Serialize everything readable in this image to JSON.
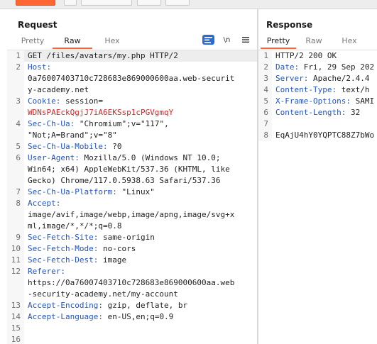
{
  "request": {
    "title": "Request",
    "tabs": [
      {
        "label": "Pretty",
        "active": false
      },
      {
        "label": "Raw",
        "active": true
      },
      {
        "label": "Hex",
        "active": false
      }
    ],
    "tools": {
      "newline_label": "\\n",
      "menu_icon": "hamburger-icon",
      "wrap_icon": "word-wrap-icon"
    },
    "lines": [
      {
        "n": "1",
        "parts": [
          {
            "t": "GET /files/avatars/my.php HTTP/2",
            "k": "plain"
          }
        ]
      },
      {
        "n": "2",
        "parts": [
          {
            "t": "Host:",
            "k": "name"
          }
        ],
        "cont": [
          "0a76007403710c728683e869000600aa.web-securit",
          "y-academy.net"
        ]
      },
      {
        "n": "3",
        "parts": [
          {
            "t": "Cookie:",
            "k": "name"
          },
          {
            "t": " session=",
            "k": "plain"
          }
        ],
        "cont_red": [
          "WDNsPAEckQgjJ7iA6EKSsp1cPGVgmqY"
        ]
      },
      {
        "n": "4",
        "parts": [
          {
            "t": "Sec-Ch-Ua:",
            "k": "name"
          },
          {
            "t": " \"Chromium\";v=\"117\",",
            "k": "plain"
          }
        ],
        "cont": [
          "\"Not;A=Brand\";v=\"8\""
        ]
      },
      {
        "n": "5",
        "parts": [
          {
            "t": "Sec-Ch-Ua-Mobile:",
            "k": "name"
          },
          {
            "t": " ?0",
            "k": "plain"
          }
        ]
      },
      {
        "n": "6",
        "parts": [
          {
            "t": "User-Agent:",
            "k": "name"
          },
          {
            "t": " Mozilla/5.0 (Windows NT 10.0;",
            "k": "plain"
          }
        ],
        "cont": [
          "Win64; x64) AppleWebKit/537.36 (KHTML, like",
          "Gecko) Chrome/117.0.5938.63 Safari/537.36"
        ]
      },
      {
        "n": "7",
        "parts": [
          {
            "t": "Sec-Ch-Ua-Platform:",
            "k": "name"
          },
          {
            "t": " \"Linux\"",
            "k": "plain"
          }
        ]
      },
      {
        "n": "8",
        "parts": [
          {
            "t": "Accept:",
            "k": "name"
          }
        ],
        "cont": [
          "image/avif,image/webp,image/apng,image/svg+x",
          "ml,image/*,*/*;q=0.8"
        ]
      },
      {
        "n": "9",
        "parts": [
          {
            "t": "Sec-Fetch-Site:",
            "k": "name"
          },
          {
            "t": " same-origin",
            "k": "plain"
          }
        ]
      },
      {
        "n": "10",
        "parts": [
          {
            "t": "Sec-Fetch-Mode:",
            "k": "name"
          },
          {
            "t": " no-cors",
            "k": "plain"
          }
        ]
      },
      {
        "n": "11",
        "parts": [
          {
            "t": "Sec-Fetch-Dest:",
            "k": "name"
          },
          {
            "t": " image",
            "k": "plain"
          }
        ]
      },
      {
        "n": "12",
        "parts": [
          {
            "t": "Referer:",
            "k": "name"
          }
        ],
        "cont": [
          "https://0a76007403710c728683e869000600aa.web",
          "-security-academy.net/my-account"
        ]
      },
      {
        "n": "13",
        "parts": [
          {
            "t": "Accept-Encoding:",
            "k": "name"
          },
          {
            "t": " gzip, deflate, br",
            "k": "plain"
          }
        ]
      },
      {
        "n": "14",
        "parts": [
          {
            "t": "Accept-Language:",
            "k": "name"
          },
          {
            "t": " en-US,en;q=0.9",
            "k": "plain"
          }
        ]
      },
      {
        "n": "15",
        "parts": []
      },
      {
        "n": "16",
        "parts": []
      }
    ]
  },
  "response": {
    "title": "Response",
    "tabs": [
      {
        "label": "Pretty",
        "active": true
      },
      {
        "label": "Raw",
        "active": false
      },
      {
        "label": "Hex",
        "active": false
      }
    ],
    "lines": [
      {
        "n": "1",
        "parts": [
          {
            "t": "HTTP/2 200 OK",
            "k": "plain"
          }
        ]
      },
      {
        "n": "2",
        "parts": [
          {
            "t": "Date:",
            "k": "name"
          },
          {
            "t": " Fri, 29 Sep 202",
            "k": "plain"
          }
        ]
      },
      {
        "n": "3",
        "parts": [
          {
            "t": "Server:",
            "k": "name"
          },
          {
            "t": " Apache/2.4.4",
            "k": "plain"
          }
        ]
      },
      {
        "n": "4",
        "parts": [
          {
            "t": "Content-Type:",
            "k": "name"
          },
          {
            "t": " text/h",
            "k": "plain"
          }
        ]
      },
      {
        "n": "5",
        "parts": [
          {
            "t": "X-Frame-Options:",
            "k": "name"
          },
          {
            "t": " SAMI",
            "k": "plain"
          }
        ]
      },
      {
        "n": "6",
        "parts": [
          {
            "t": "Content-Length:",
            "k": "name"
          },
          {
            "t": " 32",
            "k": "plain"
          }
        ]
      },
      {
        "n": "7",
        "parts": []
      },
      {
        "n": "8",
        "parts": [
          {
            "t": "EqAjU4hY0YQPTC88Z7bWo",
            "k": "plain"
          }
        ]
      }
    ]
  },
  "colors": {
    "accent": "#ff6633",
    "header_name": "#2354b8",
    "cookie_value": "#c72a2a",
    "active_tool": "#2a6bd6"
  }
}
